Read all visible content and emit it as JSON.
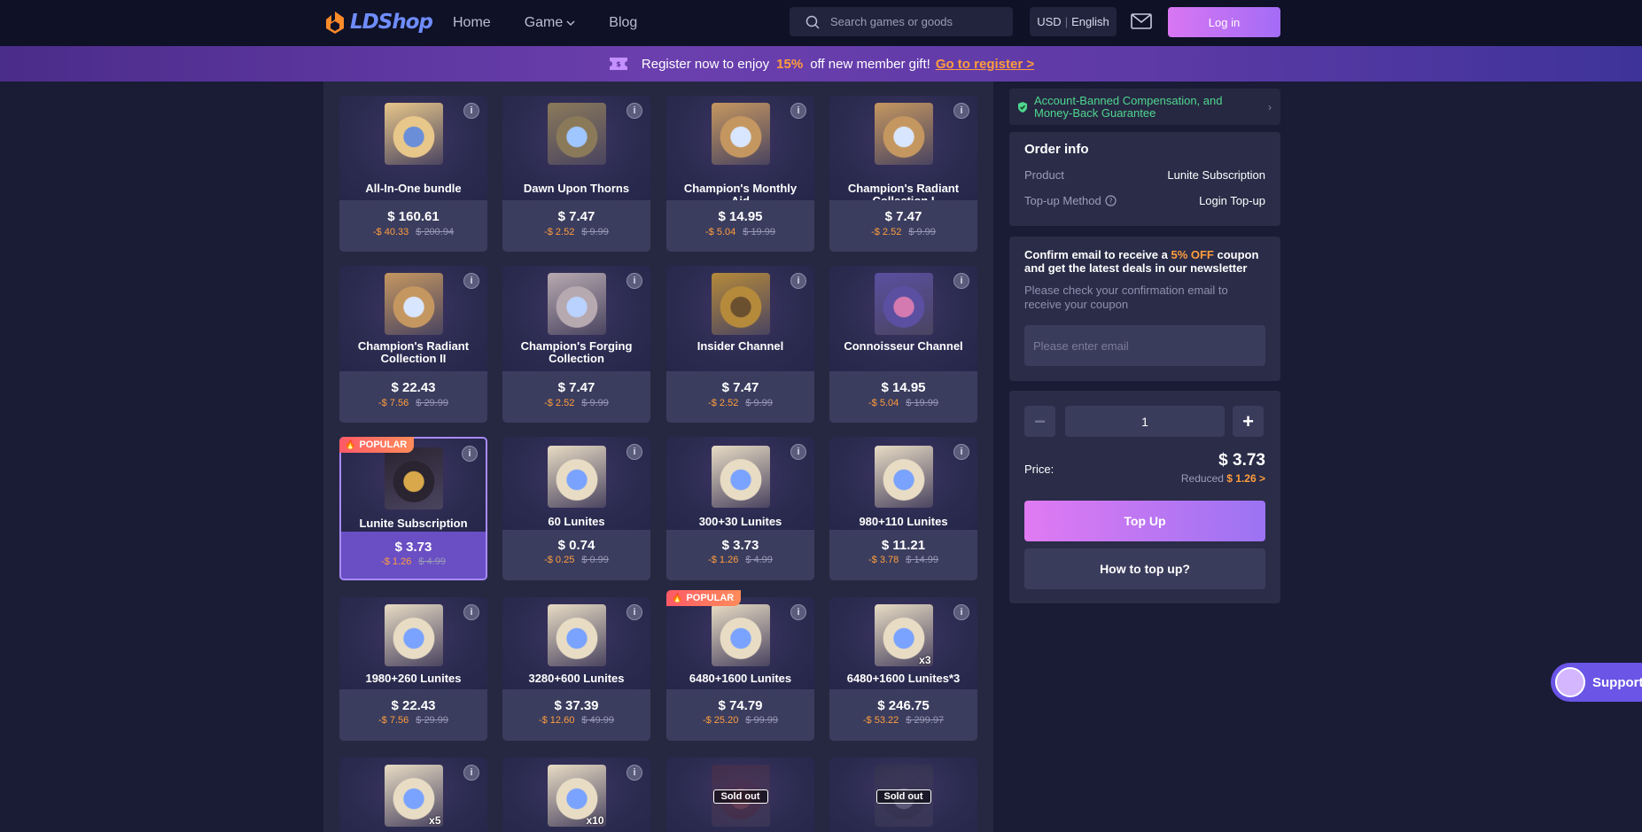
{
  "header": {
    "brand": "LDShop",
    "nav": [
      {
        "label": "Home"
      },
      {
        "label": "Game"
      },
      {
        "label": "Blog"
      }
    ],
    "search_placeholder": "Search games or goods",
    "currency": "USD",
    "language": "English",
    "login_label": "Log in"
  },
  "banner": {
    "text_before": "Register now to enjoy",
    "percent": "15%",
    "text_after": "off new member gift!",
    "link": "Go to register >"
  },
  "products": [
    {
      "name": "All-In-One bundle",
      "price": "$ 160.61",
      "off": "-$ 40.33",
      "orig": "$ 200.94"
    },
    {
      "name": "Dawn Upon Thorns",
      "price": "$ 7.47",
      "off": "-$ 2.52",
      "orig": "$ 9.99"
    },
    {
      "name": "Champion's Monthly Aid",
      "price": "$ 14.95",
      "off": "-$ 5.04",
      "orig": "$ 19.99"
    },
    {
      "name": "Champion's Radiant Collection I",
      "price": "$ 7.47",
      "off": "-$ 2.52",
      "orig": "$ 9.99"
    },
    {
      "name": "Champion's Radiant Collection II",
      "price": "$ 22.43",
      "off": "-$ 7.56",
      "orig": "$ 29.99"
    },
    {
      "name": "Champion's Forging Collection",
      "price": "$ 7.47",
      "off": "-$ 2.52",
      "orig": "$ 9.99"
    },
    {
      "name": "Insider Channel",
      "price": "$ 7.47",
      "off": "-$ 2.52",
      "orig": "$ 9.99"
    },
    {
      "name": "Connoisseur Channel",
      "price": "$ 14.95",
      "off": "-$ 5.04",
      "orig": "$ 19.99"
    },
    {
      "name": "Lunite Subscription",
      "price": "$ 3.73",
      "off": "-$ 1.26",
      "orig": "$ 4.99",
      "badge": "POPULAR"
    },
    {
      "name": "60 Lunites",
      "price": "$ 0.74",
      "off": "-$ 0.25",
      "orig": "$ 0.99"
    },
    {
      "name": "300+30 Lunites",
      "price": "$ 3.73",
      "off": "-$ 1.26",
      "orig": "$ 4.99"
    },
    {
      "name": "980+110 Lunites",
      "price": "$ 11.21",
      "off": "-$ 3.78",
      "orig": "$ 14.99"
    },
    {
      "name": "1980+260 Lunites",
      "price": "$ 22.43",
      "off": "-$ 7.56",
      "orig": "$ 29.99"
    },
    {
      "name": "3280+600 Lunites",
      "price": "$ 37.39",
      "off": "-$ 12.60",
      "orig": "$ 49.99"
    },
    {
      "name": "6480+1600 Lunites",
      "price": "$ 74.79",
      "off": "-$ 25.20",
      "orig": "$ 99.99",
      "badge": "POPULAR"
    },
    {
      "name": "6480+1600 Lunites*3",
      "price": "$ 246.75",
      "off": "-$ 53.22",
      "orig": "$ 299.97",
      "mult": "x3"
    },
    {
      "mult": "x5"
    },
    {
      "mult": "x10"
    },
    {
      "soldout": "Sold out"
    },
    {
      "soldout": "Sold out"
    }
  ],
  "guarantee": "Account-Banned Compensation, and Money-Back Guarantee",
  "order": {
    "title": "Order info",
    "product_label": "Product",
    "product_value": "Lunite Subscription",
    "method_label": "Top-up Method",
    "method_value": "Login Top-up"
  },
  "newsletter": {
    "title_a": "Confirm email to receive a",
    "title_hl": "5% OFF",
    "title_b": "coupon and get the latest deals in our newsletter",
    "sub": "Please check your confirmation email to receive your coupon",
    "placeholder": "Please enter email"
  },
  "purchase": {
    "quantity": "1",
    "price_label": "Price:",
    "price": "$ 3.73",
    "reduced_label": "Reduced",
    "reduced_amount": "$ 1.26 >",
    "topup_label": "Top Up",
    "howto_label": "How to top up?"
  },
  "support_label": "Support",
  "colors": {
    "accent": "#a36cf5",
    "discount": "#ff9d3d",
    "guarantee": "#4fd68d",
    "bg": "#1a1b35"
  }
}
